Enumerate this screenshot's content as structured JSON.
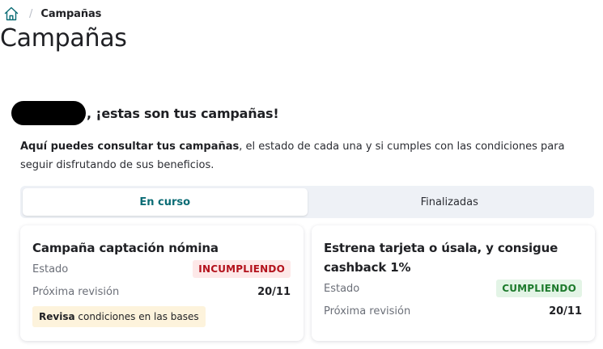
{
  "breadcrumb": {
    "home_icon": "home-icon",
    "separator": "/",
    "current": "Campañas"
  },
  "page": {
    "title": "Campañas"
  },
  "greeting": {
    "text": ", ¡estas son tus campañas!"
  },
  "description": {
    "bold": "Aquí puedes consultar tus campañas",
    "rest": ", el estado de cada una y si cumples con las condiciones para seguir disfrutando de sus beneficios."
  },
  "tabs": [
    {
      "label": "En curso",
      "active": true
    },
    {
      "label": "Finalizadas",
      "active": false
    }
  ],
  "cards": [
    {
      "title": "Campaña captación nómina",
      "state_label": "Estado",
      "state_value": "INCUMPLIENDO",
      "review_label": "Próxima revisión",
      "review_value": "20/11",
      "note_bold": "Revisa",
      "note_rest": " condiciones en las bases"
    },
    {
      "title": "Estrena tarjeta o úsala, y consigue cashback 1%",
      "state_label": "Estado",
      "state_value": "CUMPLIENDO",
      "review_label": "Próxima revisión",
      "review_value": "20/11"
    }
  ],
  "colors": {
    "accent": "#0b6c75",
    "danger": "#b3121c",
    "success": "#1d7a2c",
    "note_bg": "#fdf3dc"
  }
}
